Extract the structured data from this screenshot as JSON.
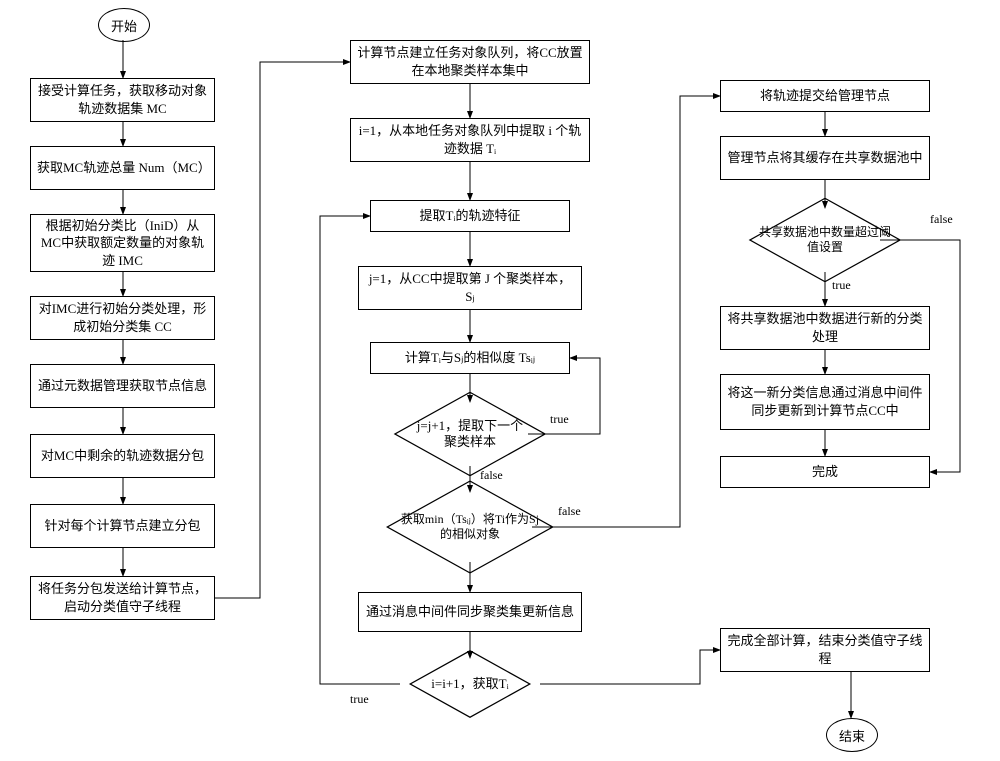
{
  "start": "开始",
  "end": "结束",
  "col1": {
    "b1": "接受计算任务，获取移动对象轨迹数据集 MC",
    "b2": "获取MC轨迹总量 Num（MC）",
    "b3": "根据初始分类比（IniD）从MC中获取额定数量的对象轨迹 IMC",
    "b4": "对IMC进行初始分类处理，形成初始分类集 CC",
    "b5": "通过元数据管理获取节点信息",
    "b6": "对MC中剩余的轨迹数据分包",
    "b7": "针对每个计算节点建立分包",
    "b8": "将任务分包发送给计算节点，启动分类值守子线程"
  },
  "col2": {
    "b1": "计算节点建立任务对象队列，将CC放置在本地聚类样本集中",
    "b2": "i=1，从本地任务对象队列中提取 i 个轨迹数据 Tᵢ",
    "b3": "提取Tᵢ的轨迹特征",
    "b4": "j=1，从CC中提取第 J 个聚类样本，Sⱼ",
    "b5": "计算Tᵢ与Sⱼ的相似度 Tsᵢⱼ",
    "d1": "j=j+1，提取下一个聚类样本",
    "d2": "获取min（Tsᵢⱼ）将Ti作为Sj的相似对象",
    "b6": "通过消息中间件同步聚类集更新信息",
    "d3": "i=i+1，获取Tᵢ"
  },
  "col3": {
    "b1": "将轨迹提交给管理节点",
    "b2": "管理节点将其缓存在共享数据池中",
    "d1": "共享数据池中数量超过阈值设置",
    "b3": "将共享数据池中数据进行新的分类处理",
    "b4": "将这一新分类信息通过消息中间件同步更新到计算节点CC中",
    "b5": "完成",
    "b6": "完成全部计算，结束分类值守子线程"
  },
  "labels": {
    "true": "true",
    "false": "false"
  }
}
